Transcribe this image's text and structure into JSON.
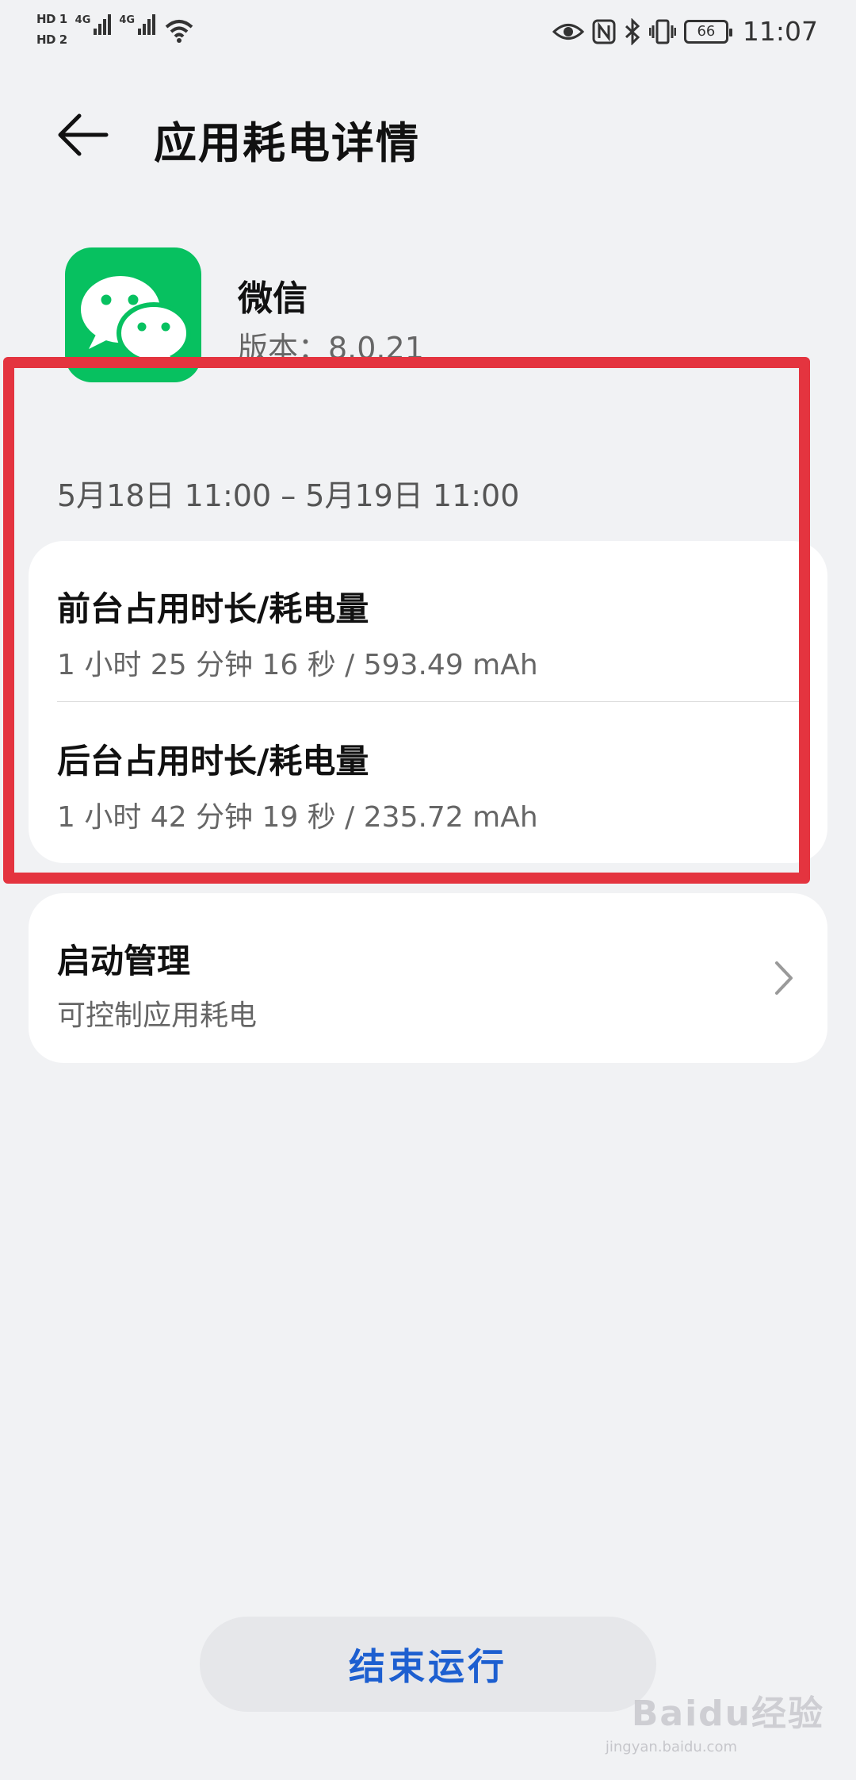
{
  "status_bar": {
    "sim1": "HD 1",
    "sim2": "HD 2",
    "net1": "4G",
    "net2": "4G",
    "battery": "66",
    "time": "11:07",
    "icons": [
      "eye-icon",
      "nfc-icon",
      "bluetooth-icon",
      "vibrate-icon",
      "battery-icon"
    ]
  },
  "header": {
    "back_icon": "back-arrow-icon",
    "title": "应用耗电详情"
  },
  "app": {
    "name": "微信",
    "version": "版本：8.0.21",
    "icon": "wechat-icon",
    "icon_color": "#07c160"
  },
  "usage": {
    "date_range": "5月18日 11:00 – 5月19日 11:00",
    "foreground": {
      "title": "前台占用时长/耗电量",
      "value": "1 小时 25 分钟 16 秒 / 593.49 mAh"
    },
    "background": {
      "title": "后台占用时长/耗电量",
      "value": "1 小时 42 分钟 19 秒 / 235.72 mAh"
    }
  },
  "launch": {
    "title": "启动管理",
    "subtitle": "可控制应用耗电",
    "chevron_icon": "chevron-right-icon"
  },
  "actions": {
    "end_label": "结束运行",
    "accent": "#1d5fd0"
  },
  "annotation": {
    "highlight_color": "#e4343f"
  },
  "watermark": {
    "text": "Baidu经验",
    "sub": "jingyan.baidu.com"
  }
}
